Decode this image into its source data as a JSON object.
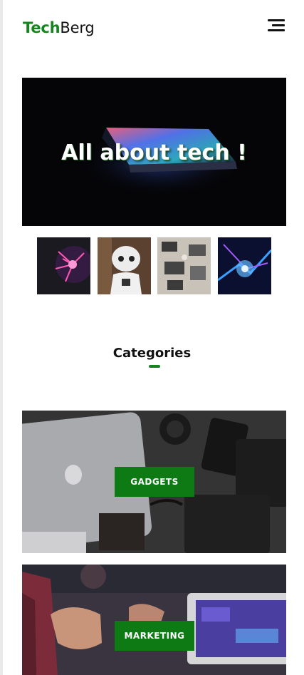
{
  "header": {
    "logo_primary": "Tech",
    "logo_secondary": "Berg",
    "menu_icon": "hamburger-menu-icon"
  },
  "hero": {
    "title": "All about tech !"
  },
  "thumbnails": [
    {
      "name": "plasma-ball"
    },
    {
      "name": "robot"
    },
    {
      "name": "workspace"
    },
    {
      "name": "circuit-lights"
    }
  ],
  "categories": {
    "title": "Categories",
    "items": [
      {
        "label": "GADGETS"
      },
      {
        "label": "MARKETING"
      }
    ]
  },
  "colors": {
    "accent": "#15851e",
    "button": "#0e7a14",
    "text": "#111111"
  }
}
